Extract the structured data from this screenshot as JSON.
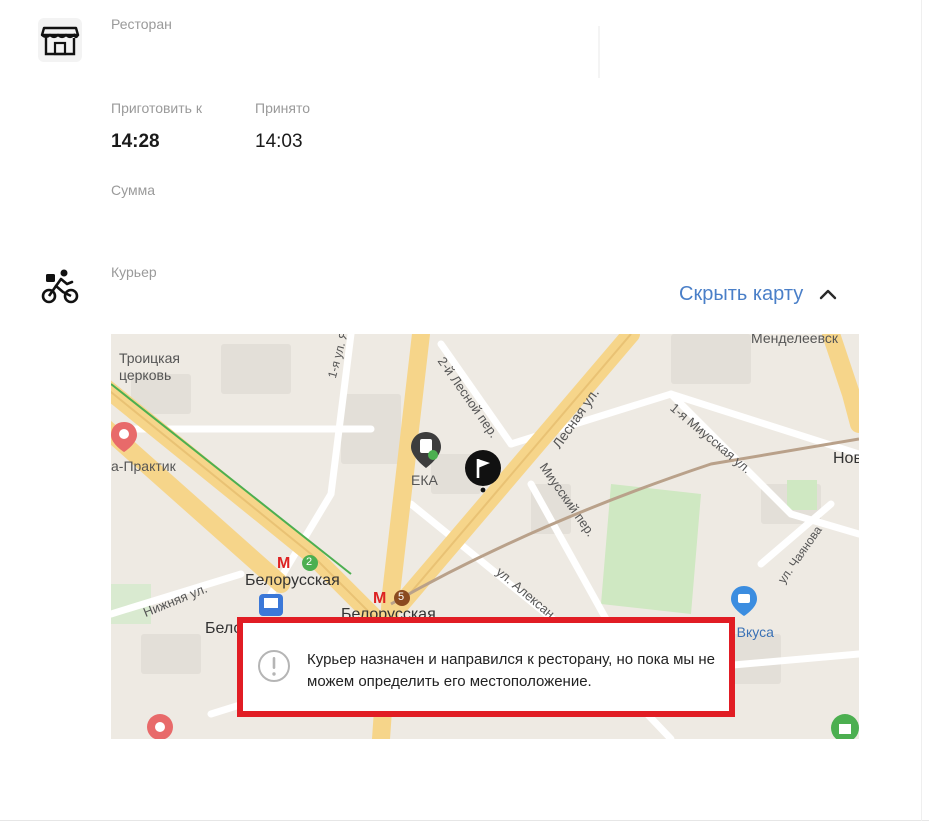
{
  "restaurant": {
    "label": "Ресторан"
  },
  "times": {
    "prepare_label": "Приготовить к",
    "prepare_value": "14:28",
    "accepted_label": "Принято",
    "accepted_value": "14:03"
  },
  "sum": {
    "label": "Сумма"
  },
  "courier": {
    "label": "Курьер"
  },
  "map_toggle": {
    "label": "Скрыть карту",
    "icon": "chevron-up-icon"
  },
  "map": {
    "labels": {
      "church": "Троицкая\nцерковь",
      "street_1": "1-я ул. Я",
      "lesnoy_2": "2-й Лесной пер.",
      "lesnaya": "Лесная ул.",
      "mendeleev": "Менделеевск",
      "miusskaya_1": "1-я Миусская ул.",
      "praktik": "а-Практик",
      "eka": "ЕКА",
      "miussky": "Миусский пер.",
      "nov": "Нов",
      "chayanova": "ул. Чаянова",
      "nizhnyaya": "Нижняя ул.",
      "belorusskaya_2": "Белорусская",
      "belorusskaya_5": "Белорусская",
      "alexandrova": "ул. Алексан",
      "vkusa": "а Вкуса",
      "belo": "Бело",
      "metro_2": "2",
      "metro_5": "5",
      "metro_m": "М"
    },
    "colors": {
      "road_major": "#f6d58a",
      "road_minor": "#ffffff",
      "park": "#cfe8c2",
      "railway": "#b9a18a",
      "metro_line": "#4caf50"
    }
  },
  "notice": {
    "icon": "exclamation-circle-icon",
    "text": "Курьер назначен и направился к ресторану, но пока мы не можем определить его местоположение."
  }
}
